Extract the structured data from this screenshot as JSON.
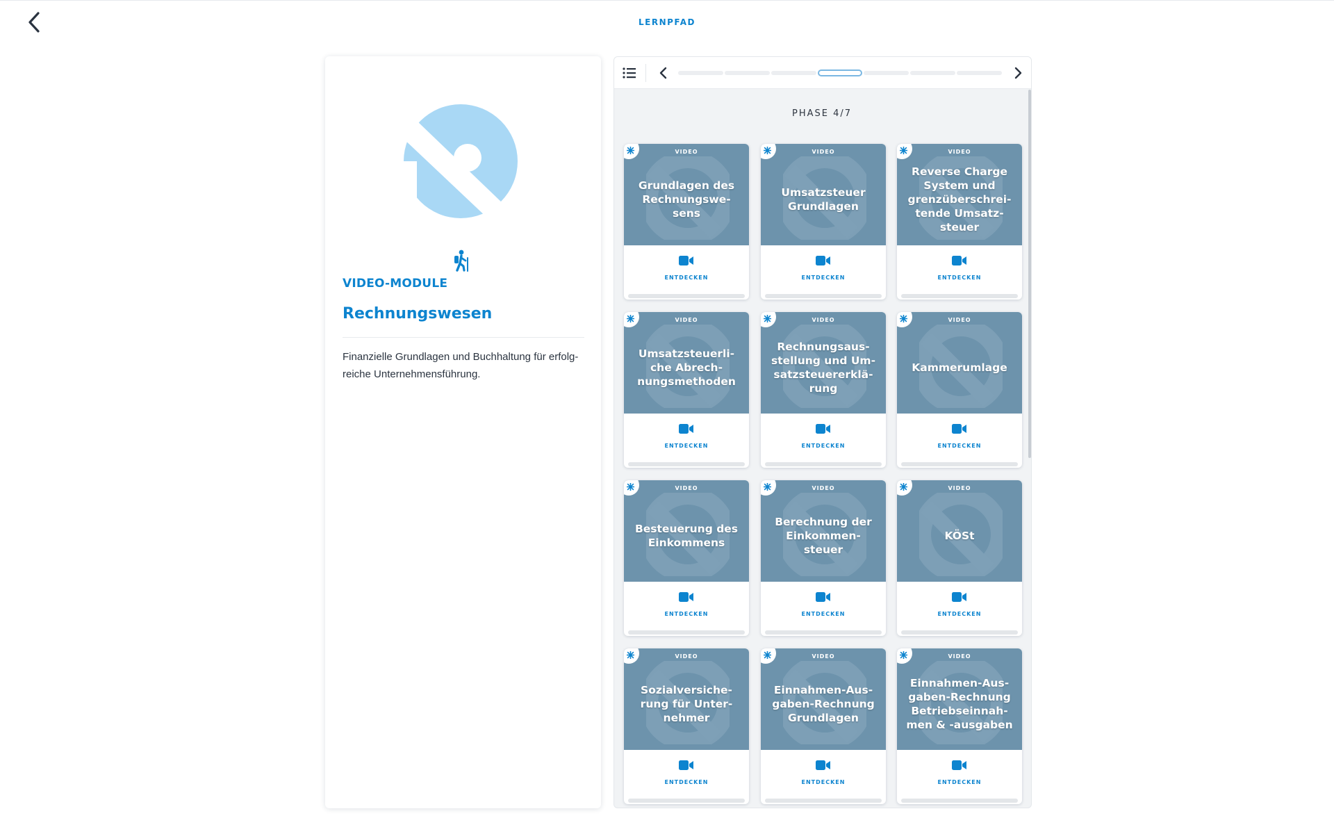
{
  "header": {
    "title": "LERNPFAD",
    "back_icon": "chevron-left-icon"
  },
  "module": {
    "type_label": "VIDEO-MODULE",
    "title": "Rechnungswesen",
    "description": "Finanzielle Grundlagen und Buchhaltung für erfolg-reiche Unternehmensführung.",
    "icons": [
      "brand-logo-icon",
      "hiker-icon"
    ]
  },
  "path_nav": {
    "list_icon": "list-icon",
    "prev_icon": "chevron-left-icon",
    "next_icon": "chevron-right-icon",
    "phase_label": "PHASE 4/7",
    "phase_count": 7,
    "active_phase": 4
  },
  "cards": [
    {
      "type": "VIDEO",
      "title": "Grundlagen des Rechnungswe-sens",
      "action": "ENTDECKEN"
    },
    {
      "type": "VIDEO",
      "title": "Umsatzsteuer Grundlagen",
      "action": "ENTDECKEN"
    },
    {
      "type": "VIDEO",
      "title": "Reverse Charge System und grenzüberschrei-tende Umsatz-steuer",
      "action": "ENTDECKEN"
    },
    {
      "type": "VIDEO",
      "title": "Umsatzsteuerli-che Abrech-nungsmethoden",
      "action": "ENTDECKEN"
    },
    {
      "type": "VIDEO",
      "title": "Rechnungsaus-stellung und Um-satzsteuererklä-rung",
      "action": "ENTDECKEN"
    },
    {
      "type": "VIDEO",
      "title": "Kammerumlage",
      "action": "ENTDECKEN"
    },
    {
      "type": "VIDEO",
      "title": "Besteuerung des Einkommens",
      "action": "ENTDECKEN"
    },
    {
      "type": "VIDEO",
      "title": "Berechnung der Einkommen-steuer",
      "action": "ENTDECKEN"
    },
    {
      "type": "VIDEO",
      "title": "KÖSt",
      "action": "ENTDECKEN"
    },
    {
      "type": "VIDEO",
      "title": "Sozialversiche-rung für Unter-nehmer",
      "action": "ENTDECKEN"
    },
    {
      "type": "VIDEO",
      "title": "Einnahmen-Aus-gaben-Rechnung Grundlagen",
      "action": "ENTDECKEN"
    },
    {
      "type": "VIDEO",
      "title": "Einnahmen-Aus-gaben-Rechnung Betriebseinnah-men & -ausgaben",
      "action": "ENTDECKEN"
    }
  ],
  "colors": {
    "accent": "#0d84cf",
    "logo_light": "#a9d8f5",
    "card_header": "#6d93ac"
  }
}
